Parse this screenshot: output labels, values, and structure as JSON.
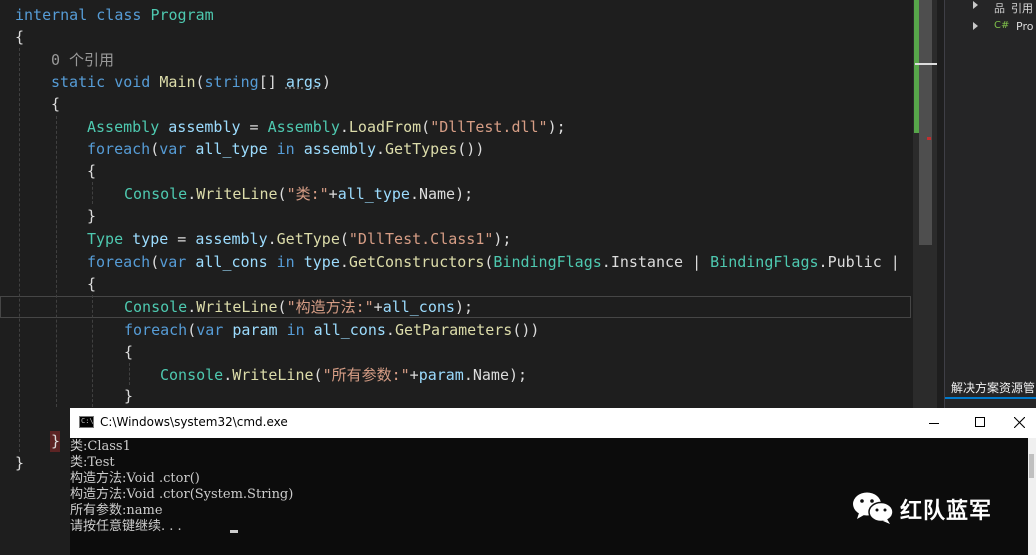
{
  "editor": {
    "lines": {
      "l1": {
        "kw1": "internal",
        "kw2": "class",
        "name": "Program"
      },
      "l2": {
        "text": "{"
      },
      "l3": {
        "codelens": "0 个引用"
      },
      "l4": {
        "kw1": "static",
        "kw2": "void",
        "fn": "Main",
        "open": "(",
        "ty": "string",
        "br": "[] ",
        "arg": "args",
        "close": ")"
      },
      "l5": {
        "text": "{"
      },
      "l6": {
        "ty": "Assembly",
        "var": "assembly",
        "eq": " = ",
        "cls": "Assembly",
        "dot": ".",
        "fn": "LoadFrom",
        "open": "(",
        "str": "\"DllTest.dll\"",
        "close": ");"
      },
      "l7": {
        "kw": "foreach",
        "open": "(",
        "kw2": "var",
        "var": "all_type",
        "kw3": "in",
        "obj": "assembly",
        "dot": ".",
        "fn": "GetTypes",
        "close": "())"
      },
      "l8": {
        "text": "{"
      },
      "l9": {
        "cls": "Console",
        "dot": ".",
        "fn": "WriteLine",
        "open": "(",
        "str": "\"类:\"",
        "plus": "+",
        "var": "all_type",
        "dot2": ".",
        "prop": "Name",
        "close": ");"
      },
      "l10": {
        "text": "}"
      },
      "l11": {
        "ty": "Type",
        "var": "type",
        "eq": " = ",
        "obj": "assembly",
        "dot": ".",
        "fn": "GetType",
        "open": "(",
        "str": "\"DllTest.Class1\"",
        "close": ");"
      },
      "l12": {
        "kw": "foreach",
        "open": "(",
        "kw2": "var",
        "var": "all_cons",
        "kw3": "in",
        "obj": "type",
        "dot": ".",
        "fn": "GetConstructors",
        "open2": "(",
        "en1": "BindingFlags",
        "dot2": ".",
        "m1": "Instance",
        "bar": " | ",
        "en2": "BindingFlags",
        "dot3": ".",
        "m2": "Public",
        "bar2": " |"
      },
      "l13": {
        "text": "{"
      },
      "l14": {
        "cls": "Console",
        "dot": ".",
        "fn": "WriteLine",
        "open": "(",
        "str": "\"构造方法:\"",
        "plus": "+",
        "var": "all_cons",
        "close": ");"
      },
      "l15": {
        "kw": "foreach",
        "open": "(",
        "kw2": "var",
        "var": "param",
        "kw3": "in",
        "obj": "all_cons",
        "dot": ".",
        "fn": "GetParameters",
        "close": "())"
      },
      "l16": {
        "text": "{"
      },
      "l17": {
        "cls": "Console",
        "dot": ".",
        "fn": "WriteLine",
        "open": "(",
        "str": "\"所有参数:\"",
        "plus": "+",
        "var": "param",
        "dot2": ".",
        "prop": "Name",
        "close": ");"
      },
      "l18": {
        "text": "}"
      },
      "l19": {
        "text": "}"
      },
      "l20": {
        "text": "}"
      }
    }
  },
  "solution_explorer": {
    "items": [
      {
        "icon": "品",
        "label": "引用"
      },
      {
        "icon": "C#",
        "label": "Pro"
      }
    ],
    "title": "解决方案资源管"
  },
  "cmd_window": {
    "title": "C:\\Windows\\system32\\cmd.exe",
    "icon_text": "C:\\",
    "output": [
      "类:Class1",
      "类:Test",
      "构造方法:Void .ctor()",
      "构造方法:Void .ctor(System.String)",
      "所有参数:name",
      "请按任意键继续. . ."
    ]
  },
  "watermark": {
    "text": "红队蓝军"
  },
  "colors": {
    "editor_bg": "#1e1e1e",
    "keyword": "#569cd6",
    "type": "#4ec9b0",
    "method": "#dcdcaa",
    "string": "#d69d85",
    "variable": "#9cdcfe",
    "change_bar": "#57a64a",
    "console_bg": "#0c0c0c"
  }
}
